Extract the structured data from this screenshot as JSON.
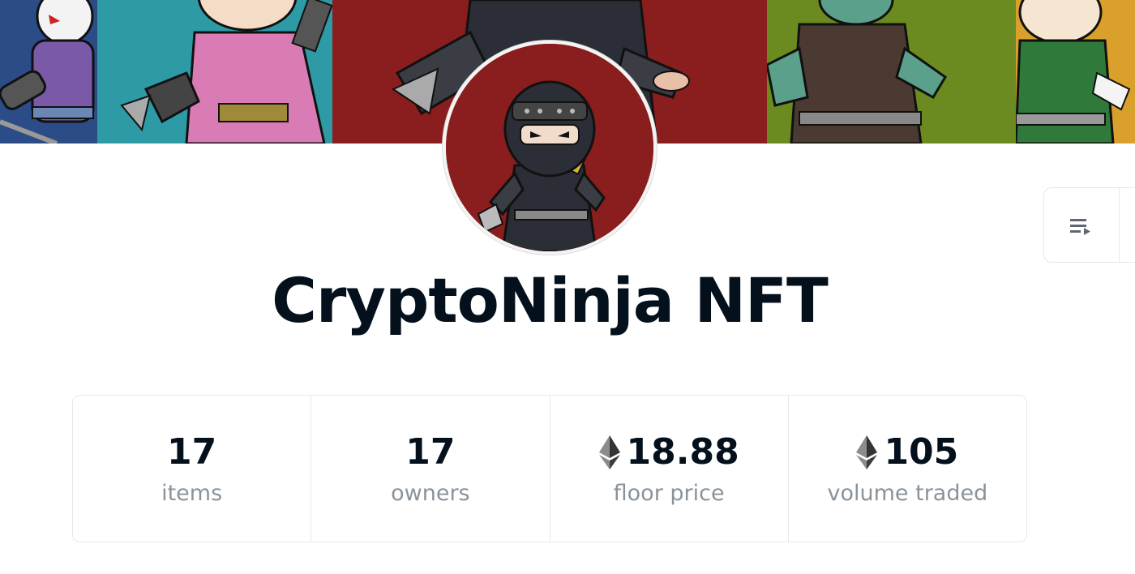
{
  "collection": {
    "name": "CryptoNinja NFT"
  },
  "stats": [
    {
      "value": "17",
      "label": "items",
      "currency_icon": ""
    },
    {
      "value": "17",
      "label": "owners",
      "currency_icon": ""
    },
    {
      "value": "18.88",
      "label": "floor price",
      "currency_icon": "ethereum-icon"
    },
    {
      "value": "105",
      "label": "volume traded",
      "currency_icon": "ethereum-icon"
    }
  ],
  "toolbar": {
    "icon": "playlist-icon"
  },
  "colors": {
    "banner_blue": "#2b4c86",
    "banner_teal": "#2e9aa6",
    "banner_red": "#8a1d1d",
    "banner_olive": "#6b8a1f",
    "banner_orange": "#d9a12c",
    "text_primary": "#04111d",
    "text_secondary": "#8a939b",
    "border": "#e5e8eb"
  }
}
